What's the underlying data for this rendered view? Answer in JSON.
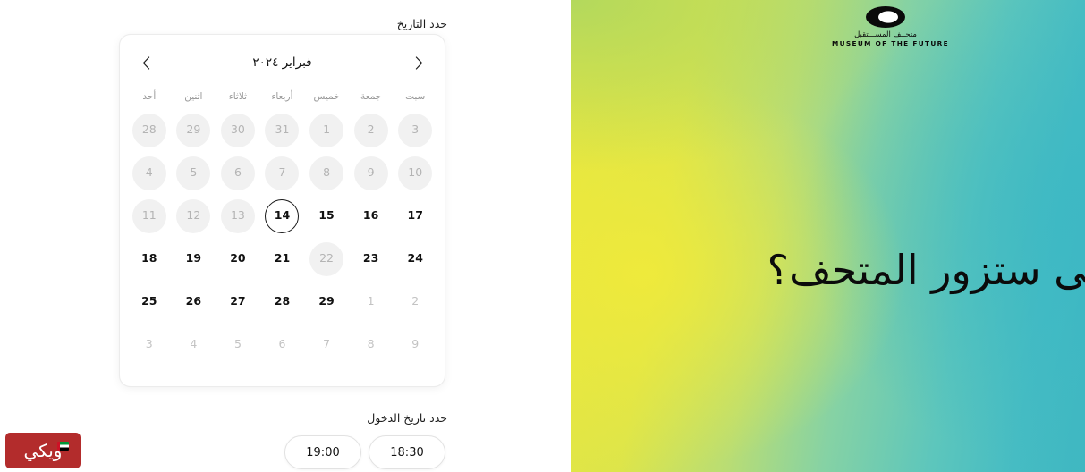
{
  "page": {
    "language": "ar",
    "accent_black": "#111111",
    "gradient_from": "#e6e63f",
    "gradient_mid": "#b9dd74",
    "gradient_to": "#3fb7c1"
  },
  "booking": {
    "date_label": "حدد التاريخ",
    "entry_label": "حدد تاريخ الدخول"
  },
  "calendar": {
    "month_title": "فبراير ٢٠٢٤",
    "prev_icon": "chevron-left-icon",
    "next_icon": "chevron-right-icon",
    "weekdays": [
      "أحد",
      "اثنين",
      "ثلاثاء",
      "أربعاء",
      "خميس",
      "جمعة",
      "سبت"
    ],
    "weeks": [
      [
        {
          "n": "28",
          "state": "blocked"
        },
        {
          "n": "29",
          "state": "blocked"
        },
        {
          "n": "30",
          "state": "blocked"
        },
        {
          "n": "31",
          "state": "blocked"
        },
        {
          "n": "1",
          "state": "blocked"
        },
        {
          "n": "2",
          "state": "blocked"
        },
        {
          "n": "3",
          "state": "blocked"
        }
      ],
      [
        {
          "n": "4",
          "state": "blocked"
        },
        {
          "n": "5",
          "state": "blocked"
        },
        {
          "n": "6",
          "state": "blocked"
        },
        {
          "n": "7",
          "state": "blocked"
        },
        {
          "n": "8",
          "state": "blocked"
        },
        {
          "n": "9",
          "state": "blocked"
        },
        {
          "n": "10",
          "state": "blocked"
        }
      ],
      [
        {
          "n": "11",
          "state": "blocked"
        },
        {
          "n": "12",
          "state": "blocked"
        },
        {
          "n": "13",
          "state": "blocked"
        },
        {
          "n": "14",
          "state": "selected"
        },
        {
          "n": "15",
          "state": "avail"
        },
        {
          "n": "16",
          "state": "avail"
        },
        {
          "n": "17",
          "state": "avail"
        }
      ],
      [
        {
          "n": "18",
          "state": "avail"
        },
        {
          "n": "19",
          "state": "avail"
        },
        {
          "n": "20",
          "state": "avail"
        },
        {
          "n": "21",
          "state": "avail"
        },
        {
          "n": "22",
          "state": "blocked"
        },
        {
          "n": "23",
          "state": "avail"
        },
        {
          "n": "24",
          "state": "avail"
        }
      ],
      [
        {
          "n": "25",
          "state": "avail"
        },
        {
          "n": "26",
          "state": "avail"
        },
        {
          "n": "27",
          "state": "avail"
        },
        {
          "n": "28",
          "state": "avail"
        },
        {
          "n": "29",
          "state": "avail"
        },
        {
          "n": "1",
          "state": "muted"
        },
        {
          "n": "2",
          "state": "muted"
        }
      ],
      [
        {
          "n": "3",
          "state": "muted"
        },
        {
          "n": "4",
          "state": "muted"
        },
        {
          "n": "5",
          "state": "muted"
        },
        {
          "n": "6",
          "state": "muted"
        },
        {
          "n": "7",
          "state": "muted"
        },
        {
          "n": "8",
          "state": "muted"
        },
        {
          "n": "9",
          "state": "muted"
        }
      ]
    ],
    "selected_day": "14"
  },
  "time_slots": [
    {
      "time": "19:00"
    },
    {
      "time": "18:30"
    }
  ],
  "hero": {
    "headline": "متى ستزور المتحف؟",
    "logo": {
      "mark": "museum-of-the-future-ellipse-logo",
      "arabic": "متحــف المســـتقبل",
      "english": "MUSEUM OF THE FUTURE"
    }
  },
  "watermark": {
    "text": "ويكي",
    "flag": "uae-flag-icon",
    "color": "#b32c2c"
  }
}
